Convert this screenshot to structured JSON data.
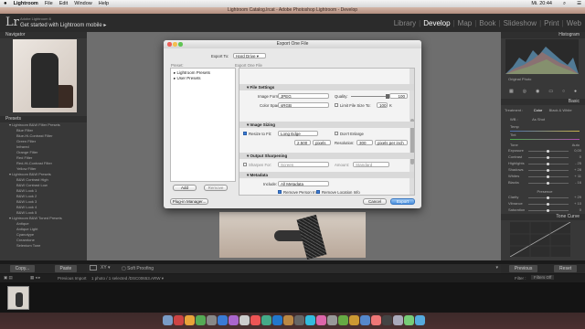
{
  "menubar": {
    "apple": "",
    "app": "Lightroom",
    "items": [
      "File",
      "Edit",
      "Window",
      "Help"
    ],
    "clock": "Mi. 20:44"
  },
  "window": {
    "title": "Lightroom Catalog.lrcat - Adobe Photoshop Lightroom - Develop"
  },
  "identity": {
    "small": "Adobe Lightroom 6",
    "big": "Get started with Lightroom mobile ▸"
  },
  "modules": [
    "Library",
    "Develop",
    "Map",
    "Book",
    "Slideshow",
    "Print",
    "Web"
  ],
  "active_module": "Develop",
  "left": {
    "navigator": "Navigator",
    "presets": "Presets",
    "preset_items": [
      "▾ Lightroom B&W Filter Presets",
      "Blue Filter",
      "Blue-Hi-Contrast Filter",
      "Green Filter",
      "Infrared",
      "Orange Filter",
      "Red Filter",
      "Red-Hi-Contrast Filter",
      "Yellow Filter",
      "▾ Lightroom B&W Presets",
      "B&W Contrast High",
      "B&W Contrast Low",
      "B&W Look 1",
      "B&W Look 2",
      "B&W Look 3",
      "B&W Look 4",
      "B&W Look 5",
      "▾ Lightroom B&W Toned Presets",
      "Antique",
      "Antique Light",
      "Cyanotype",
      "Creamtone",
      "Selenium Tone"
    ],
    "copy": "Copy...",
    "paste": "Paste"
  },
  "right": {
    "histogram": "Histogram",
    "original_photo": "Original Photo",
    "basic": "Basic",
    "treatment": "Treatment :",
    "color": "Color",
    "bw": "Black & White",
    "wb": "WB :",
    "as_shot": "As Shot",
    "temp": "Temp",
    "tint": "Tint",
    "tone": "Tone",
    "auto": "Auto",
    "basic_rows": [
      {
        "l": "Exposure",
        "v": "0,00"
      },
      {
        "l": "Contrast",
        "v": "0"
      },
      {
        "l": "Highlights",
        "v": "- 25"
      },
      {
        "l": "Shadows",
        "v": "+ 28"
      },
      {
        "l": "Whites",
        "v": "+ 11"
      },
      {
        "l": "Blacks",
        "v": "- 16"
      }
    ],
    "presence": "Presence",
    "presence_rows": [
      {
        "l": "Clarity",
        "v": "+ 29"
      },
      {
        "l": "Vibrance",
        "v": "+ 10"
      },
      {
        "l": "Saturation",
        "v": "0"
      }
    ],
    "tone_curve": "Tone Curve",
    "previous": "Previous",
    "reset": "Reset"
  },
  "toolbar": {
    "soft_proofing": "Soft Proofing"
  },
  "filmstrip": {
    "previous_import": "Previous Import",
    "count": "1 photo / 1 selected /DSC00653.ARW ▾",
    "filter": "Filter :",
    "filters_off": "Filters Off"
  },
  "dialog": {
    "title": "Export One File",
    "export_to_label": "Export To:",
    "export_to_value": "Hard Drive",
    "preset_header": "Preset:",
    "export_header": "Export One File",
    "preset_items": [
      "▸ Lightroom Presets",
      "▸ User Presets"
    ],
    "add": "Add",
    "remove": "Remove",
    "file_settings": "File Settings",
    "image_format_label": "Image Format:",
    "image_format": "JPEG",
    "quality_label": "Quality:",
    "quality": "100",
    "color_space_label": "Color Space:",
    "color_space": "sRGB",
    "limit_label": "Limit File Size To:",
    "limit_value": "100",
    "limit_unit": "K",
    "image_sizing": "Image Sizing",
    "resize_label": "Resize to Fit:",
    "resize_value": "Long Edge",
    "dont_enlarge": "Don't Enlarge",
    "size_value": "2.500",
    "size_unit": "pixels",
    "resolution_label": "Resolution:",
    "resolution": "300",
    "resolution_unit": "pixels per inch",
    "output_sharpening": "Output Sharpening",
    "sharpen_label": "Sharpen For:",
    "sharpen_value": "Screen",
    "amount_label": "Amount:",
    "amount_value": "Standard",
    "metadata": "Metadata",
    "include_label": "Include:",
    "include_value": "All Metadata",
    "remove_person": "Remove Person Info",
    "remove_location": "Remove Location Info",
    "plugin": "Plug-in Manager...",
    "cancel": "Cancel",
    "export": "Export"
  },
  "colors": {
    "accent": "#4a8fde",
    "panel": "#383838",
    "center": "#6e6e6e"
  }
}
